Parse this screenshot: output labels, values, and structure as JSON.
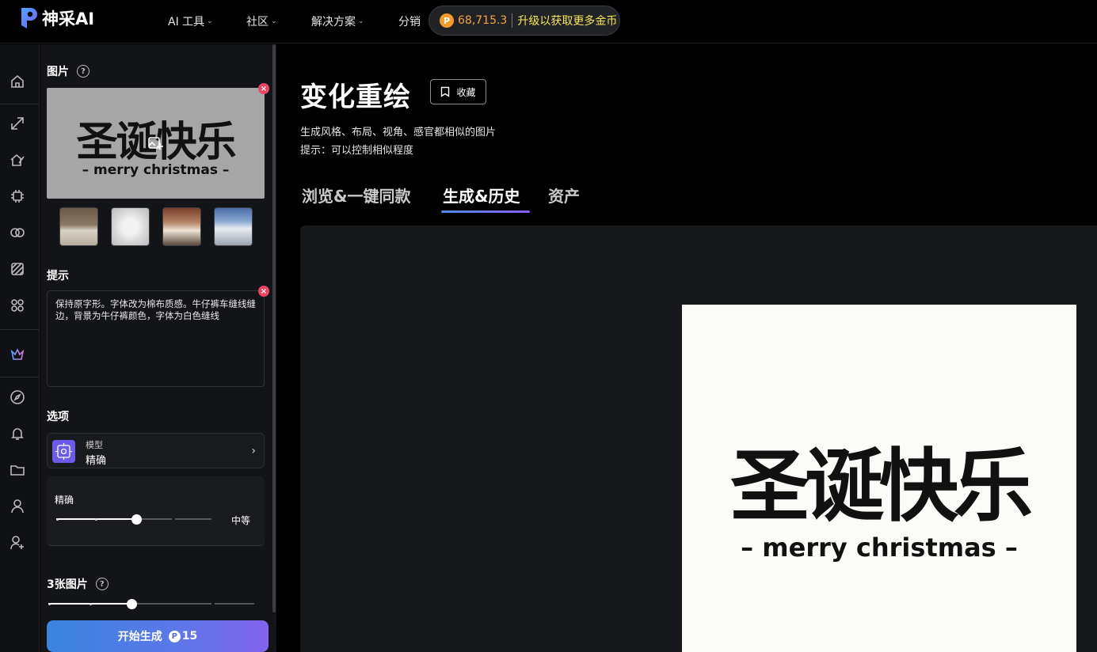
{
  "app": {
    "logo_text": "神采AI"
  },
  "topnav": {
    "items": [
      {
        "label": "AI 工具",
        "has_menu": true
      },
      {
        "label": "社区",
        "has_menu": true
      },
      {
        "label": "解决方案",
        "has_menu": true
      },
      {
        "label": "分销",
        "has_menu": false
      }
    ],
    "coins": {
      "value": "68,715.3",
      "upgrade_label": "升级以获取更多金币",
      "color": "#f4a340"
    }
  },
  "rail": {
    "icons": [
      "home-icon",
      "edit-tool-icon",
      "home-design-icon",
      "chip-icon",
      "rings-icon",
      "pattern-icon",
      "apps-grid-icon",
      "crown-icon",
      "compass-icon",
      "bell-icon",
      "folder-icon",
      "user-icon",
      "user-add-icon"
    ]
  },
  "panel": {
    "image_section": {
      "title": "图片",
      "preview_big_text": "圣诞快乐",
      "preview_sub_text": "– merry christmas –"
    },
    "prompt_section": {
      "title": "提示",
      "value": "保持原字形。字体改为棉布质感。牛仔裤车缝线缝边，背景为牛仔裤颜色，字体为白色缝线"
    },
    "options_section": {
      "title": "选项",
      "model_label": "模型",
      "model_value": "精确",
      "precision_label": "精确",
      "precision_value": "中等",
      "precision_level": 0.5
    },
    "count_section": {
      "title": "3张图片",
      "level": 0.5
    },
    "generate": {
      "label": "开始生成",
      "cost": "15"
    }
  },
  "main": {
    "title": "变化重绘",
    "favorite_label": "收藏",
    "desc_line1": "生成风格、布局、视角、感官都相似的图片",
    "desc_line2": "提示：可以控制相似程度",
    "tabs": [
      {
        "label": "浏览&一键同款",
        "active": false
      },
      {
        "label": "生成&历史",
        "active": true
      },
      {
        "label": "资产",
        "active": false
      }
    ],
    "result": {
      "big_text": "圣诞快乐",
      "sub_text": "– merry christmas –"
    }
  }
}
